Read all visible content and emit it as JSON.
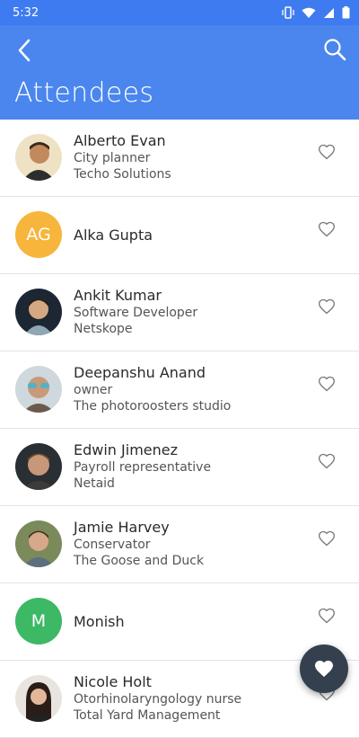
{
  "status": {
    "time": "5:32"
  },
  "header": {
    "title": "Attendees"
  },
  "attendees": [
    {
      "name": "Alberto Evan",
      "title": "City planner",
      "company": "Techo Solutions"
    },
    {
      "name": "Alka Gupta",
      "initials": "AG",
      "color": "#f7b53b"
    },
    {
      "name": "Ankit Kumar",
      "title": "Software Developer",
      "company": "Netskope"
    },
    {
      "name": "Deepanshu Anand",
      "title": "owner",
      "company": "The photoroosters studio"
    },
    {
      "name": "Edwin Jimenez",
      "title": "Payroll representative",
      "company": "Netaid"
    },
    {
      "name": "Jamie Harvey",
      "title": "Conservator",
      "company": "The Goose and Duck"
    },
    {
      "name": "Monish",
      "initials": "M",
      "color": "#3db864"
    },
    {
      "name": "Nicole Holt",
      "title": "Otorhinolaryngology nurse",
      "company": "Total Yard Management"
    }
  ],
  "colors": {
    "accent": "#4a86ee",
    "fab": "#35404f"
  },
  "icons": [
    "back-arrow-icon",
    "search-icon",
    "heart-outline-icon",
    "heart-filled-icon"
  ]
}
